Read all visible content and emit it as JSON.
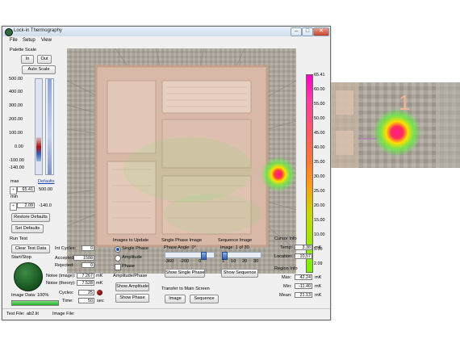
{
  "window": {
    "title": "Lock-in Thermography",
    "menu": [
      "File",
      "Setup",
      "View"
    ],
    "controls": {
      "minimize": "–",
      "maximize": "□",
      "close": "✕"
    }
  },
  "palette": {
    "label": "Palette Scale",
    "in_label": "In",
    "out_label": "Out",
    "auto_scale_label": "Auto Scale",
    "scale_ticks": [
      "500.00",
      "400.00",
      "300.00",
      "200.00",
      "100.00",
      "0.00",
      "-100.00",
      "-140.00"
    ],
    "defaults_link": "Defaults",
    "max_label": "max",
    "max_value": "65.41",
    "max_default": "500.00",
    "min_label": "min",
    "min_value": "2.09",
    "min_default": "-140.0",
    "restore_defaults_label": "Restore Defaults",
    "set_defaults_label": "Set Defaults"
  },
  "colorbar": {
    "labels": [
      "65.41",
      "60.00",
      "55.00",
      "50.00",
      "45.00",
      "40.00",
      "35.00",
      "30.00",
      "25.00",
      "20.00",
      "15.00",
      "10.00",
      "5.00",
      "2.09"
    ]
  },
  "run_test": {
    "label": "Run Test",
    "clear_label": "Clear Test Data",
    "start_stop_label": "Start/Stop",
    "image_data_label": "Image Data: 100%",
    "int_cycles_label": "Int Cycles:",
    "int_cycles_value": "0",
    "accepted_label": "Accepted:",
    "accepted_value": "1588",
    "rejected_label": "Rejected:",
    "rejected_value": "0",
    "noise_image_label": "Noise (image):",
    "noise_image_value": "7.267",
    "noise_image_unit": "mK",
    "noise_theory_label": "Noise (theory):",
    "noise_theory_value": "7.528",
    "noise_theory_unit": "mK",
    "cycles_label": "Cycles:",
    "cycles_value": "25",
    "time_label": "Time:",
    "time_value": "50",
    "time_unit": "sec"
  },
  "images_to_update": {
    "label": "Images to Update",
    "options": [
      "Single Phase",
      "Amplitude"
    ],
    "selected_option": "Single Phase",
    "phase_checkbox": "Phase",
    "amp_phase_label": "Amplitude/Phase",
    "show_amplitude_label": "Show Amplitude",
    "show_phase_label": "Show Phase"
  },
  "single_phase": {
    "label": "Single Phase Image",
    "phase_angle_label": "Phase Angle: 0°",
    "ticks": [
      "-360",
      "-200",
      "0"
    ],
    "show_label": "Show Single Phase"
  },
  "sequence": {
    "label": "Sequence Image",
    "image_label": "Image: 1 of 30",
    "ticks": [
      "1",
      "10",
      "20",
      "30"
    ],
    "show_label": "Show Sequence"
  },
  "transfer": {
    "label": "Transfer to Main Screen",
    "image_label": "Image",
    "sequence_label": "Sequence"
  },
  "cursor_info": {
    "label": "Cursor Info",
    "temp_label": "Temp:",
    "temp_value": "3.38",
    "temp_unit": "mK",
    "location_label": "Location:",
    "location_value": "10,57"
  },
  "region_info": {
    "label": "Region Info",
    "max_label": "Max:",
    "max_value": "42.24",
    "max_unit": "mK",
    "min_label": "Min:",
    "min_value": "-11.40",
    "min_unit": "mK",
    "mean_label": "Mean:",
    "mean_value": "21.13",
    "mean_unit": "mK"
  },
  "status": {
    "test_file_label": "Test File:",
    "test_file_value": "ab2.lit",
    "image_file_label": "Image File:"
  },
  "zoom_inset": {
    "marker": "1"
  },
  "colors": {
    "hotspot_core": "#ff1a8c",
    "hotspot_mid": "#ffe000",
    "hotspot_edge": "#6ee84a",
    "start_button": "#1b5a24"
  }
}
